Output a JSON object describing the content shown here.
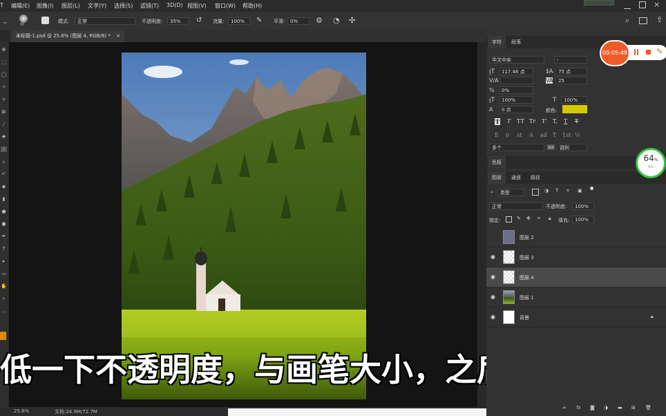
{
  "menubar": {
    "items": [
      "编辑(E)",
      "图像(I)",
      "图层(L)",
      "文字(Y)",
      "选择(S)",
      "滤镜(T)",
      "3D(D)",
      "视图(V)",
      "窗口(W)",
      "帮助(H)"
    ]
  },
  "options": {
    "brush_size": "95",
    "mode_label": "模式:",
    "mode_value": "正常",
    "opacity_label": "不透明度:",
    "opacity_value": "35%",
    "flow_label": "流量:",
    "flow_value": "100%",
    "smooth_label": "平滑:",
    "smooth_value": "0%"
  },
  "document": {
    "tab_title": "未标题-1.psd @ 25.6% (图层 4, RGB/8) *",
    "tab_close": "×",
    "zoom": "25.6%",
    "doc_info": "文档:24.9M/72.7M"
  },
  "subtitle": "低一下不透明度，与画笔大小，之后涂抹",
  "character_panel": {
    "tabs": [
      "字符",
      "段落"
    ],
    "font_family": "华文中宋",
    "font_style": "-",
    "font_size": "117.46 点",
    "leading": "75 点",
    "kerning": "",
    "tracking": "25",
    "scale_percent": "0%",
    "vertical_scale": "100%",
    "horizontal_scale": "100%",
    "baseline_shift": "0 点",
    "color_label": "颜色:",
    "text_color": "#d4c800",
    "format_buttons": [
      "T",
      "T",
      "TT",
      "Tr",
      "T'",
      "T,",
      "T",
      "T"
    ],
    "opentype_buttons": [
      "fi",
      "σ",
      "st",
      "A",
      "ad",
      "T",
      "1st",
      "½"
    ],
    "language": "多个",
    "antialias_icon": "aa-icon",
    "antialias": "锐利"
  },
  "swatches_panel": {
    "tab": "色板"
  },
  "layers_panel": {
    "tabs": [
      "图层",
      "通道",
      "路径"
    ],
    "filter_kind": "类型",
    "blend_mode": "正常",
    "opacity_label": "不透明度:",
    "opacity_value": "100%",
    "lock_label": "锁定:",
    "fill_label": "填充:",
    "fill_value": "100%",
    "layers": [
      {
        "name": "图层 2",
        "visible": false,
        "selected": false,
        "thumb": "#6b6f8a"
      },
      {
        "name": "图层 3",
        "visible": true,
        "selected": false,
        "thumb": "checker"
      },
      {
        "name": "图层 4",
        "visible": true,
        "selected": true,
        "thumb": "checker"
      },
      {
        "name": "图层 1",
        "visible": true,
        "selected": false,
        "thumb": "landscape"
      },
      {
        "name": "背景",
        "visible": true,
        "selected": false,
        "thumb": "#ffffff",
        "locked": true
      }
    ],
    "bottom_icons": [
      "link-icon",
      "fx-icon",
      "mask-icon",
      "adjustment-icon",
      "group-icon",
      "new-layer-icon",
      "delete-icon"
    ]
  },
  "recorder": {
    "time": "00:05:49"
  },
  "net_gauge": {
    "percent": "64",
    "unit": "%",
    "speed": "K/s"
  },
  "colors": {
    "foreground": "#e08a00",
    "record_accent": "#ee5a2a",
    "gauge_green": "#37c23f"
  }
}
